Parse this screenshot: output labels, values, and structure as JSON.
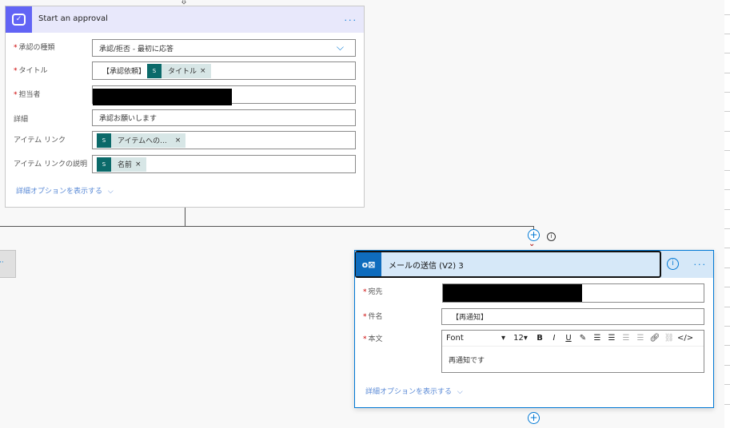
{
  "approval": {
    "title": "Start an approval",
    "more": "...",
    "fields": [
      {
        "label": "承認の種類",
        "required": true,
        "value": "承認/拒否 - 最初に応答"
      },
      {
        "label": "タイトル",
        "required": true,
        "prefix": "【承認依頼】",
        "token": "タイトル"
      },
      {
        "label": "担当者",
        "required": true
      },
      {
        "label": "詳細",
        "required": false,
        "value": "承認お願いします"
      },
      {
        "label": "アイテム リンク",
        "required": false,
        "token": "アイテムへの..."
      },
      {
        "label": "アイテム リンクの説明",
        "required": false,
        "token": "名前"
      }
    ],
    "advanced": "詳細オプションを表示する"
  },
  "mail": {
    "title": "メールの送信 (V2) 3",
    "more": "...",
    "fields": [
      {
        "label": "宛先",
        "required": true
      },
      {
        "label": "件名",
        "required": true,
        "value": "【再通知】"
      },
      {
        "label": "本文",
        "required": true,
        "value": "再通知です"
      }
    ],
    "toolbar": {
      "font": "Font",
      "size": "12"
    },
    "advanced": "詳細オプションを表示する"
  },
  "colors": {
    "approval_accent": "#6264f5",
    "mail_accent": "#0f6cbd",
    "required": "#cc0000"
  }
}
